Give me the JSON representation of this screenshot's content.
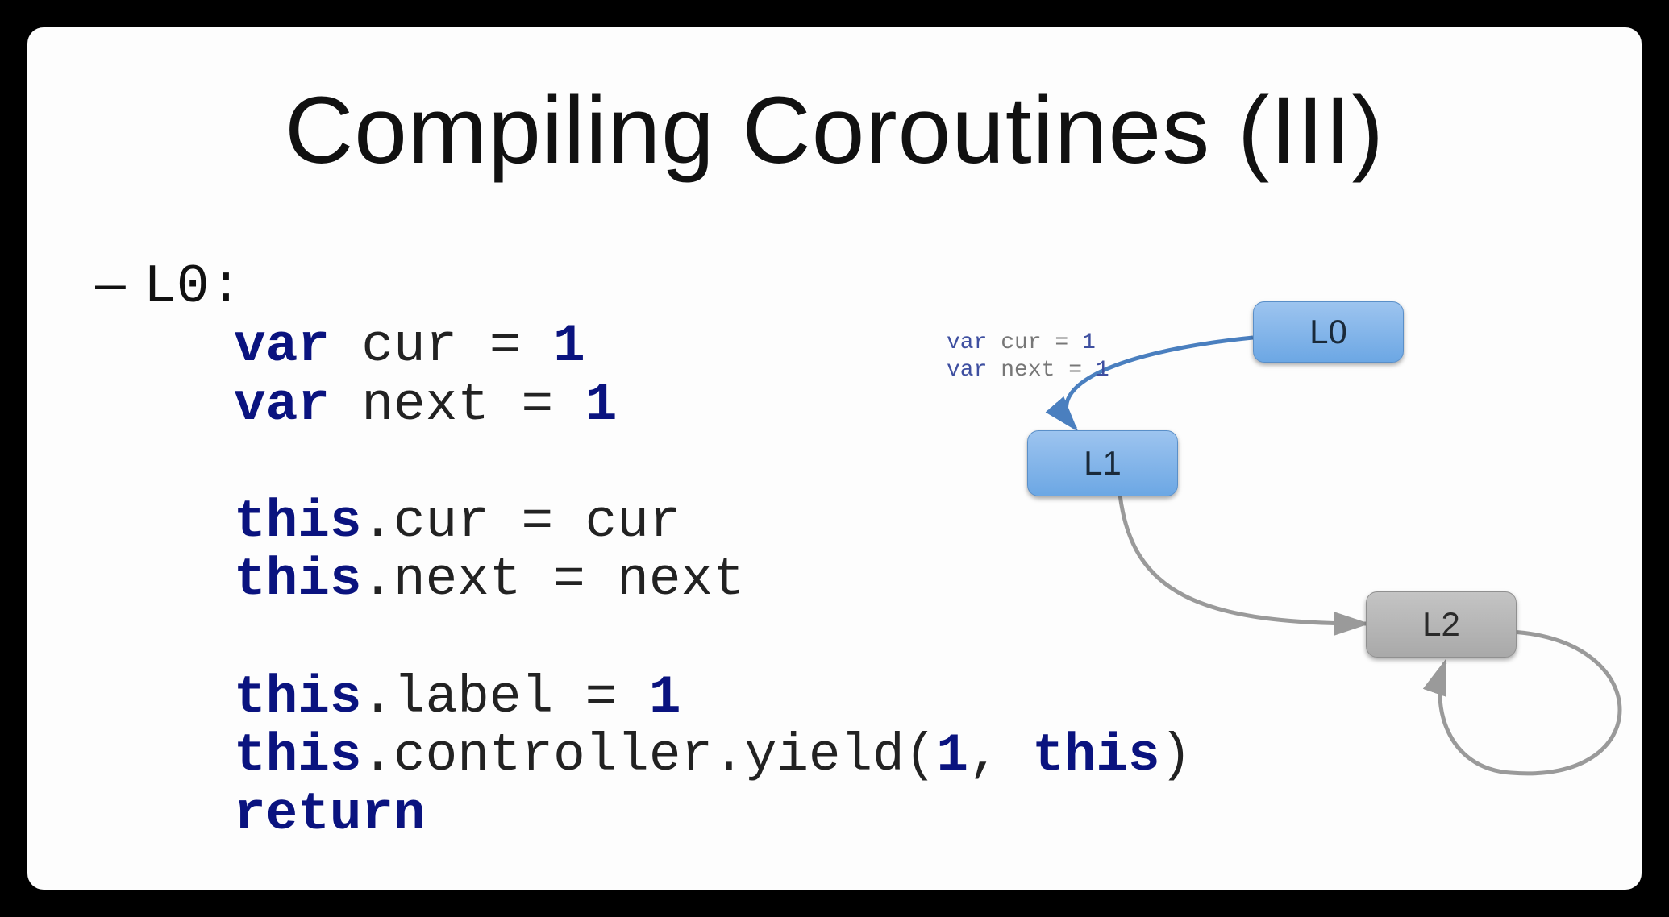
{
  "title": "Compiling Coroutines (III)",
  "bullet": "L0:",
  "code": {
    "l1_kw": "var",
    "l1_rest": " cur = ",
    "l1_num": "1",
    "l2_kw": "var",
    "l2_rest": " next = ",
    "l2_num": "1",
    "l3_kw": "this",
    "l3_rest": ".cur = cur",
    "l4_kw": "this",
    "l4_rest": ".next = next",
    "l5_kw": "this",
    "l5_rest": ".label = ",
    "l5_num": "1",
    "l6_kw": "this",
    "l6_mid": ".controller.yield(",
    "l6_num": "1",
    "l6_comma": ", ",
    "l6_kw2": "this",
    "l6_end": ")",
    "l7_kw": "return"
  },
  "diagram": {
    "nodes": {
      "L0": "L0",
      "L1": "L1",
      "L2": "L2"
    },
    "edge_label": {
      "kw1": "var",
      "rest1": " cur = ",
      "num1": "1",
      "kw2": "var",
      "rest2": " next = ",
      "num2": "1"
    }
  }
}
